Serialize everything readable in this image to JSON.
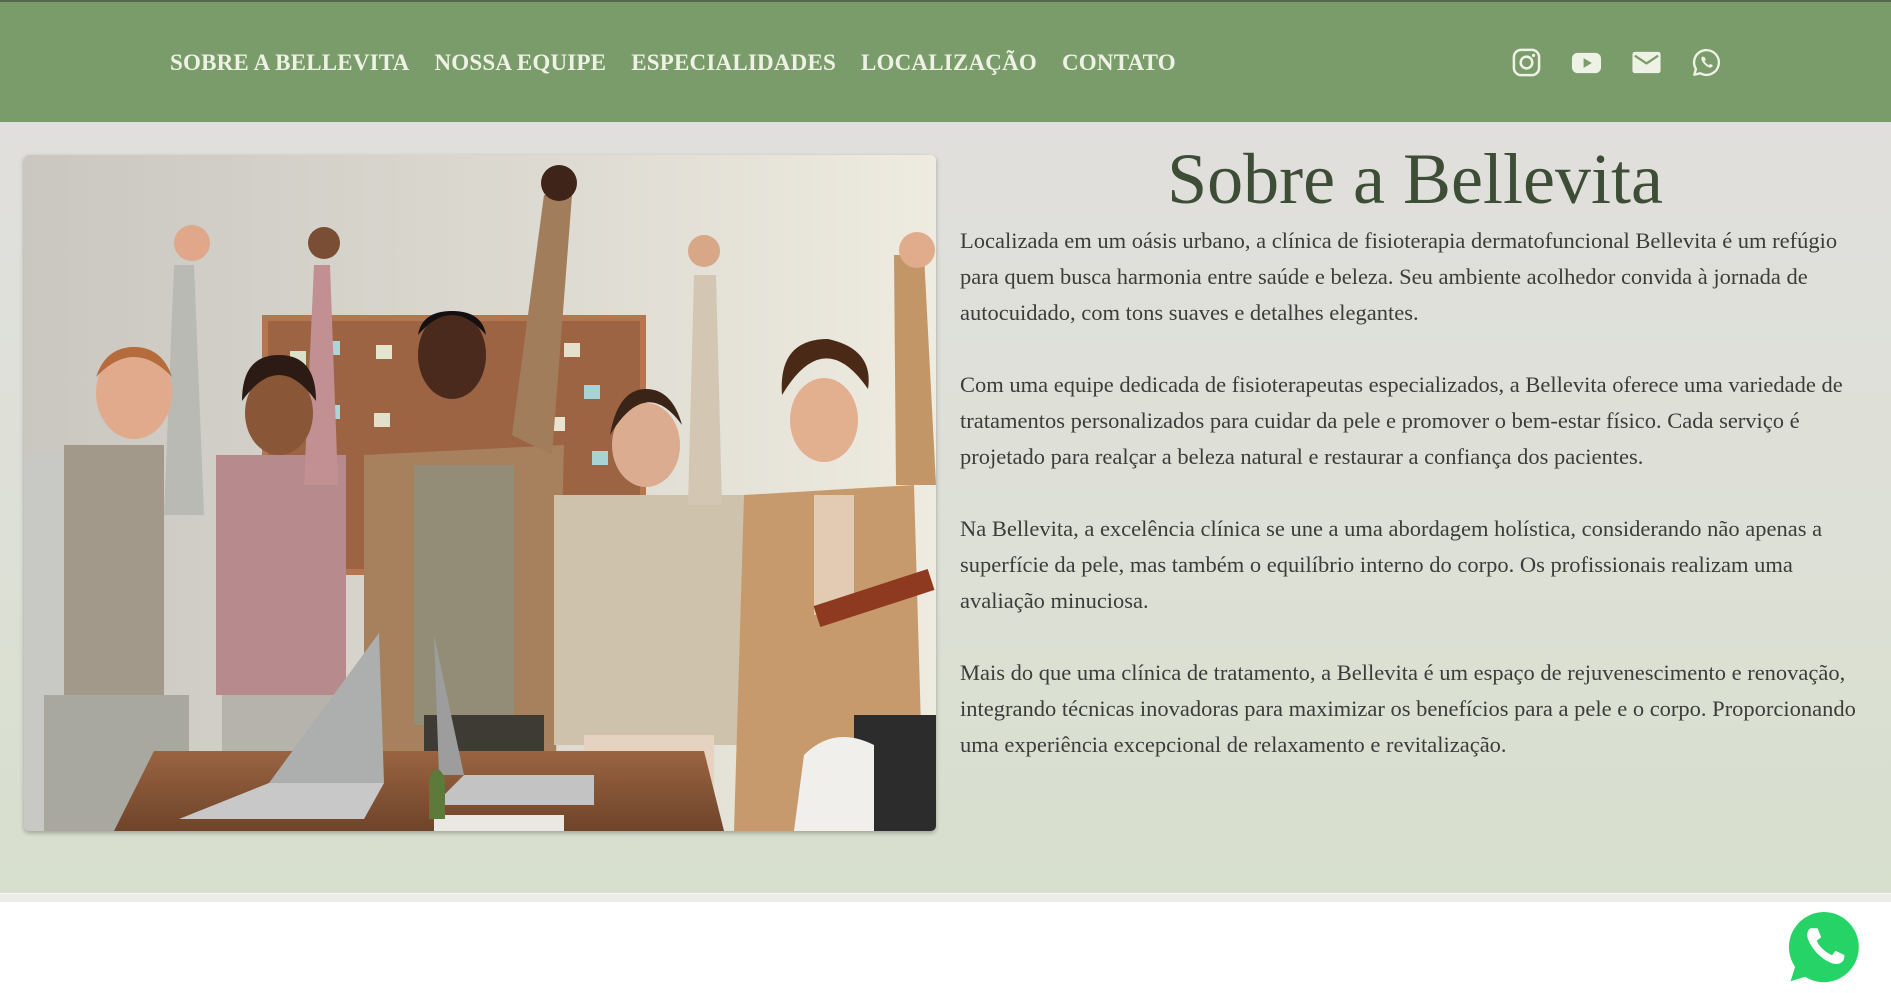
{
  "nav": {
    "items": [
      {
        "label": "SOBRE A BELLEVITA"
      },
      {
        "label": "NOSSA EQUIPE"
      },
      {
        "label": "ESPECIALIDADES"
      },
      {
        "label": "LOCALIZAÇÃO"
      },
      {
        "label": "CONTATO"
      }
    ]
  },
  "social": {
    "icons": [
      "instagram-icon",
      "youtube-icon",
      "email-icon",
      "whatsapp-icon"
    ]
  },
  "about": {
    "title": "Sobre a Bellevita",
    "paragraphs": [
      "Localizada em um oásis urbano, a clínica de fisioterapia dermatofuncional Bellevita é um refúgio para quem busca harmonia entre saúde e beleza. Seu ambiente acolhedor convida à jornada de autocuidado, com tons suaves e detalhes elegantes.",
      "Com uma equipe dedicada de fisioterapeutas especializados, a Bellevita oferece uma variedade de tratamentos personalizados para cuidar da pele e promover o bem-estar físico. Cada serviço é projetado para realçar a beleza natural e restaurar a confiança dos pacientes.",
      "Na Bellevita, a excelência clínica se une a uma abordagem holística, considerando não apenas a superfície da pele, mas também o equilíbrio interno do corpo. Os profissionais realizam uma avaliação minuciosa.",
      "Mais do que uma clínica de tratamento, a Bellevita é um espaço de rejuvenescimento e renovação, integrando técnicas inovadoras para maximizar os benefícios para a pele e o corpo. Proporcionando uma experiência excepcional de relaxamento e revitalização."
    ]
  },
  "floating": {
    "icon": "whatsapp-float-icon"
  },
  "colors": {
    "header_bg": "#7a9b6a",
    "nav_text": "#eef2e4",
    "title": "#3d4d36",
    "body_text": "#3c3c3a",
    "whatsapp": "#25d366"
  }
}
